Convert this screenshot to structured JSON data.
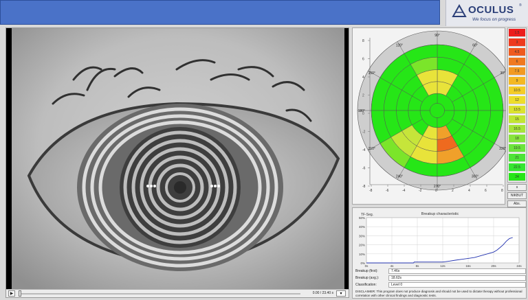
{
  "header": {
    "logo_text": "OCULUS",
    "logo_reg": "®",
    "logo_tagline": "We focus on progress"
  },
  "player": {
    "time": "0.00 / 23.40 s"
  },
  "polar_map": {
    "angle_labels": [
      "90°",
      "60°",
      "30°",
      "0°",
      "330°",
      "300°",
      "270°",
      "240°",
      "210°",
      "180°",
      "150°",
      "120°"
    ],
    "y_ticks": [
      "8",
      "6",
      "4",
      "2",
      "0",
      "-2",
      "-4",
      "-6",
      "-8"
    ],
    "x_ticks": [
      "-8",
      "-6",
      "-4",
      "-2",
      "0",
      "2",
      "4",
      "6",
      "8"
    ],
    "colors": {
      "green": "#26e617",
      "light_green": "#7be52a",
      "yellow_green": "#c6e53a",
      "yellow": "#e8e33a",
      "orange": "#f0a02a",
      "red_orange": "#ee6a1f"
    }
  },
  "scale": {
    "values": [
      "1.5",
      "3",
      "4.5",
      "6",
      "7.5",
      "9",
      "10.5",
      "12",
      "13.5",
      "15",
      "16.5",
      "18",
      "19.5",
      "21",
      "22.5",
      "24"
    ],
    "colors": [
      "#ec1d1d",
      "#ee3a1e",
      "#ef5a1f",
      "#f07920",
      "#f29a22",
      "#f4b823",
      "#f5cc27",
      "#eedd2b",
      "#dbe22f",
      "#c2e534",
      "#a7e43a",
      "#88e43c",
      "#6ce43b",
      "#4de437",
      "#34e630",
      "#26e617"
    ],
    "buttons": [
      "s",
      "NIKBUT",
      "Abs."
    ]
  },
  "breakup": {
    "title": "Breakup characteristic",
    "y_axis_label": "TF-Seg.",
    "fields": [
      {
        "label": "Breakup (first):",
        "value": "7.46s"
      },
      {
        "label": "Breakup (avg.):",
        "value": "18.62s"
      },
      {
        "label": "Classification:",
        "value": "Level 0"
      }
    ],
    "disclaimer": "DISCLAIMER: This program does not produce diagnosis and should not be used to dictate therapy without professional correlation with other clinical findings and diagnostic tests."
  },
  "chart_data": {
    "type": "line",
    "title": "Breakup characteristic",
    "xlabel": "",
    "ylabel": "TF-Seg.",
    "xlim": [
      0,
      24
    ],
    "ylim": [
      0,
      50
    ],
    "x_ticks": [
      "0s",
      "4s",
      "8s",
      "12s",
      "16s",
      "20s",
      "24s"
    ],
    "y_ticks": [
      "0%",
      "10%",
      "20%",
      "30%",
      "40%",
      "50%"
    ],
    "series": [
      {
        "x": [
          0,
          7.4,
          7.5,
          10,
          12,
          13,
          14,
          15,
          16,
          17,
          18,
          19,
          20,
          20.5,
          21,
          21.5,
          22,
          22.5,
          23
        ],
        "y": [
          0,
          0,
          1,
          1,
          1,
          2,
          3,
          4,
          5,
          6,
          8,
          10,
          12,
          14,
          17,
          20,
          24,
          27,
          28
        ]
      }
    ]
  }
}
